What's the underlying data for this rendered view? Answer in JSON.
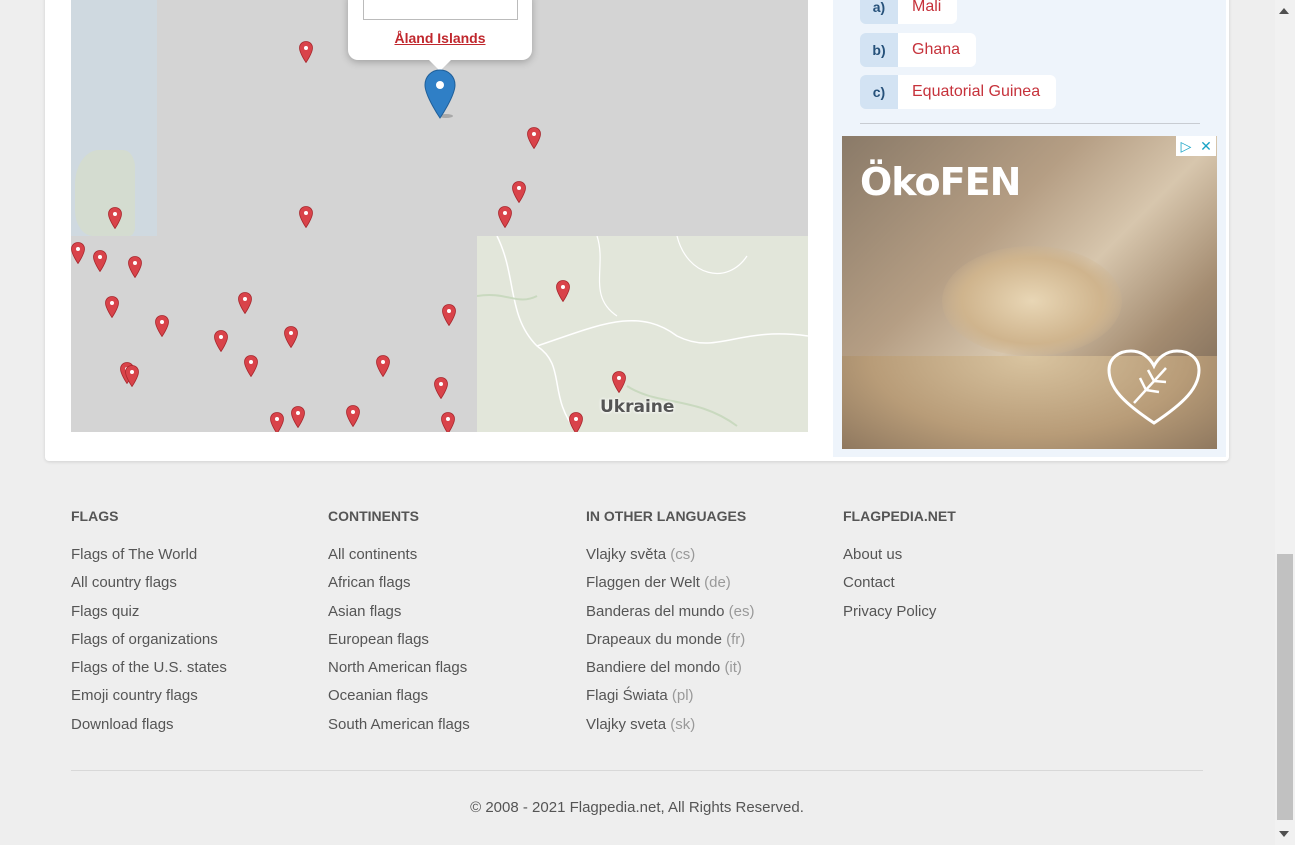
{
  "map": {
    "popup_link": "Åland Islands",
    "country_label": "Ukraine"
  },
  "quiz": {
    "options": [
      {
        "letter": "a)",
        "text": "Mali"
      },
      {
        "letter": "b)",
        "text": "Ghana"
      },
      {
        "letter": "c)",
        "text": "Equatorial Guinea"
      }
    ]
  },
  "ad": {
    "logo": "ÖkoFEN",
    "adchoices_icon": "play-triangle-icon",
    "close_icon": "close-icon"
  },
  "footer": {
    "columns": [
      {
        "title": "FLAGS",
        "links": [
          "Flags of The World",
          "All country flags",
          "Flags quiz",
          "Flags of organizations",
          "Flags of the U.S. states",
          "Emoji country flags",
          "Download flags"
        ]
      },
      {
        "title": "CONTINENTS",
        "links": [
          "All continents",
          "African flags",
          "Asian flags",
          "European flags",
          "North American flags",
          "Oceanian flags",
          "South American flags"
        ]
      },
      {
        "title": "IN OTHER LANGUAGES",
        "links": [
          {
            "text": "Vlajky světa",
            "code": "(cs)"
          },
          {
            "text": "Flaggen der Welt",
            "code": "(de)"
          },
          {
            "text": "Banderas del mundo",
            "code": "(es)"
          },
          {
            "text": "Drapeaux du monde",
            "code": "(fr)"
          },
          {
            "text": "Bandiere del mondo",
            "code": "(it)"
          },
          {
            "text": "Flagi Świata",
            "code": "(pl)"
          },
          {
            "text": "Vlajky sveta",
            "code": "(sk)"
          }
        ]
      },
      {
        "title": "FLAGPEDIA.NET",
        "links": [
          "About us",
          "Contact",
          "Privacy Policy"
        ]
      }
    ],
    "copyright": "© 2008 - 2021 Flagpedia.net, All Rights Reserved."
  },
  "colors": {
    "link_red": "#c0272d",
    "pin_red": "#d9434a",
    "pin_blue": "#2f7fc6",
    "quiz_bg": "#eef4fb"
  }
}
